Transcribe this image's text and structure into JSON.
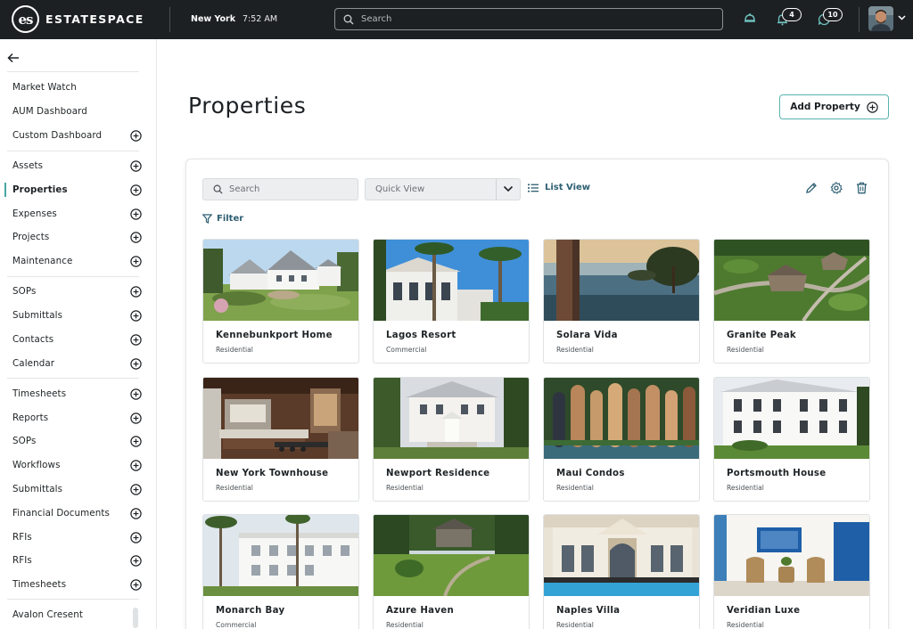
{
  "header": {
    "brand": "ESTATESPACE",
    "logo_text": "es",
    "city": "New York",
    "time": "7:52 AM",
    "search_placeholder": "Search",
    "notifications_count": "4",
    "messages_count": "10"
  },
  "sidebar": {
    "items": [
      {
        "label": "Market Watch",
        "plus": false
      },
      {
        "label": "AUM Dashboard",
        "plus": false
      },
      {
        "label": "Custom Dashboard",
        "plus": true
      },
      {
        "label": "Assets",
        "plus": true
      },
      {
        "label": "Properties",
        "plus": true,
        "active": true
      },
      {
        "label": "Expenses",
        "plus": true
      },
      {
        "label": "Projects",
        "plus": true
      },
      {
        "label": "Maintenance",
        "plus": true
      },
      {
        "label": "SOPs",
        "plus": true
      },
      {
        "label": "Submittals",
        "plus": true
      },
      {
        "label": "Contacts",
        "plus": true
      },
      {
        "label": "Calendar",
        "plus": true
      },
      {
        "label": "Timesheets",
        "plus": true
      },
      {
        "label": "Reports",
        "plus": true
      },
      {
        "label": "SOPs",
        "plus": true
      },
      {
        "label": "Workflows",
        "plus": true
      },
      {
        "label": "Submittals",
        "plus": true
      },
      {
        "label": "Financial Documents",
        "plus": true
      },
      {
        "label": "RFIs",
        "plus": true
      },
      {
        "label": "RFIs",
        "plus": true
      },
      {
        "label": "Timesheets",
        "plus": true
      },
      {
        "label": "Avalon Cresent",
        "plus": false
      }
    ]
  },
  "main": {
    "title": "Properties",
    "add_button": "Add Property",
    "search_placeholder": "Search",
    "quick_view": "Quick View",
    "list_view": "List View",
    "filter": "Filter"
  },
  "properties": [
    {
      "name": "Kennebunkport Home",
      "type": "Residential"
    },
    {
      "name": "Lagos Resort",
      "type": "Commercial"
    },
    {
      "name": "Solara Vida",
      "type": "Residential"
    },
    {
      "name": "Granite Peak",
      "type": "Residential"
    },
    {
      "name": "New York Townhouse",
      "type": "Residential"
    },
    {
      "name": "Newport Residence",
      "type": "Residential"
    },
    {
      "name": "Maui Condos",
      "type": "Residential"
    },
    {
      "name": "Portsmouth House",
      "type": "Residential"
    },
    {
      "name": "Monarch Bay",
      "type": "Commercial"
    },
    {
      "name": "Azure Haven",
      "type": "Residential"
    },
    {
      "name": "Naples Villa",
      "type": "Residential"
    },
    {
      "name": "Veridian Luxe",
      "type": "Residential"
    }
  ],
  "colors": {
    "topbar": "#1d2023",
    "accent": "#4aa5a3",
    "link": "#2e5f73"
  }
}
